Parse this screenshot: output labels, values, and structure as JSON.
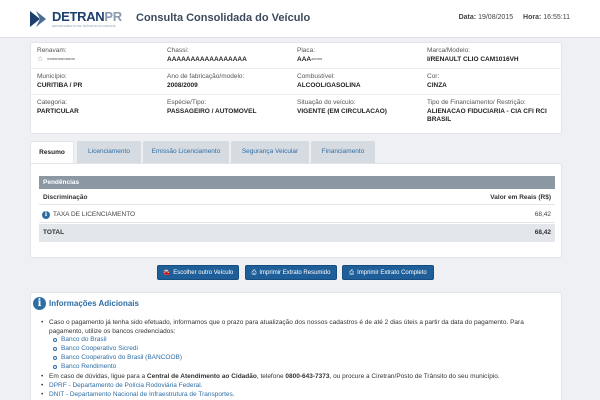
{
  "header": {
    "logo_text_main": "DETRAN",
    "logo_text_accent": "PR",
    "logo_subtitle": "DEPARTAMENTO DE TRÂNSITO DO PARANÁ",
    "title": "Consulta Consolidada do Veículo",
    "date_label": "Data:",
    "date_value": "19/08/2015",
    "time_label": "Hora:",
    "time_value": "16:55:11"
  },
  "vehicle": {
    "renavam_label": "Renavam:",
    "renavam_value": "▫▫▫▫▫▫▫▫▫▫▫▫",
    "chassi_label": "Chassi:",
    "chassi_value": "AAAAAAAAAAAAAAAAA",
    "placa_label": "Placa:",
    "placa_value": "AAA-▫▫▫▫",
    "marca_label": "Marca/Modelo:",
    "marca_value": "I/RENAULT CLIO CAM1016VH",
    "municipio_label": "Município:",
    "municipio_value": "CURITIBA / PR",
    "ano_label": "Ano de fabricação/modelo:",
    "ano_value": "2008/2009",
    "combustivel_label": "Combustível:",
    "combustivel_value": "ALCOOL/GASOLINA",
    "cor_label": "Cor:",
    "cor_value": "CINZA",
    "categoria_label": "Categoria:",
    "categoria_value": "PARTICULAR",
    "especie_label": "Espécie/Tipo:",
    "especie_value": "PASSAGEIRO / AUTOMOVEL",
    "situacao_label": "Situação do veículo:",
    "situacao_value": "VIGENTE (EM CIRCULACAO)",
    "financiamento_label": "Tipo de Financiamento/ Restrição:",
    "financiamento_value": "ALIENACAO FIDUCIARIA - CIA CFI RCI BRASIL"
  },
  "tabs": [
    {
      "label": "Resumo"
    },
    {
      "label": "Licenciamento"
    },
    {
      "label": "Emissão Licenciamento"
    },
    {
      "label": "Segurança Veicular"
    },
    {
      "label": "Financiamento"
    }
  ],
  "pendencias": {
    "title": "Pendências",
    "col_desc": "Discriminação",
    "col_value": "Valor em Reais (R$)",
    "items": [
      {
        "desc": "TAXA DE LICENCIAMENTO",
        "value": "68,42"
      }
    ],
    "total_label": "TOTAL",
    "total_value": "68,42"
  },
  "buttons": {
    "choose_vehicle": "Escolher outro Veículo",
    "print_summary": "Imprimir Extrato Resumido",
    "print_full": "Imprimir Extrato Completo"
  },
  "info": {
    "title": "Informações Adicionais",
    "para1": "Caso o pagamento já tenha sido efetuado, informamos que o prazo para atualização dos nossos cadastros é de até 2 dias úteis a partir da data do pagamento. Para pagamento, utilize os bancos credenciados:",
    "banks": [
      "Banco do Brasil",
      "Banco Cooperativo Sicredi",
      "Banco Cooperativo do Brasil (BANCOOB)",
      "Banco Rendimento"
    ],
    "help_prefix": "Em caso de dúvidas, ligue para a ",
    "help_center": "Central de Atendimento ao Cidadão",
    "help_mid": ", telefone ",
    "help_phone": "0800-643-7373",
    "help_suffix": ", ou procure a Ciretran/Posto de Trânsito do seu município.",
    "links": [
      "DPRF - Departamento de Polícia Rodoviária Federal.",
      "DNIT - Departamento Nacional de Infraestrutura de Transportes."
    ]
  },
  "colors": {
    "brand": "#1d3f6e",
    "accent": "#2e6da4",
    "button": "#1f5f99"
  }
}
